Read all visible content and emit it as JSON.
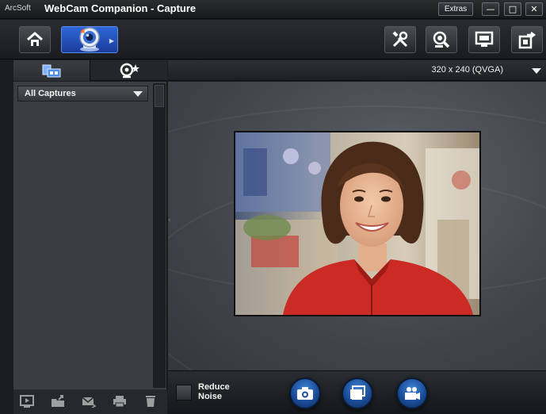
{
  "window": {
    "brand": "ArcSoft",
    "title": "WebCam Companion - Capture",
    "extras_label": "Extras",
    "minimize_symbol": "—",
    "maximize_symbol": "□",
    "close_symbol": "✕"
  },
  "toolbar": {
    "home_icon": "home-icon",
    "capture_icon": "webcam-icon",
    "tools_icon": "tools-icon",
    "zoom_icon": "magnifier-webcam-icon",
    "screen_icon": "monitor-icon",
    "export_icon": "export-icon"
  },
  "left_panel": {
    "tabs": [
      {
        "name": "captures",
        "icon": "folder-gallery-icon"
      },
      {
        "name": "effects",
        "icon": "webcam-star-icon"
      }
    ],
    "filter_value": "All Captures",
    "bottom_icons": [
      "play-icon",
      "share-folder-icon",
      "email-icon",
      "print-icon",
      "delete-icon"
    ]
  },
  "preview": {
    "resolution": "320 x 240 (QVGA)",
    "collapse_glyph": "‹"
  },
  "controls": {
    "reduce_noise_label_1": "Reduce",
    "reduce_noise_label_2": "Noise",
    "reduce_noise_checked": false,
    "buttons": [
      "camera-icon",
      "burst-capture-icon",
      "video-camera-icon"
    ]
  },
  "colors": {
    "accent": "#2f66d6",
    "panel": "#3a3e43",
    "preview_bg": "#4b4f55"
  }
}
